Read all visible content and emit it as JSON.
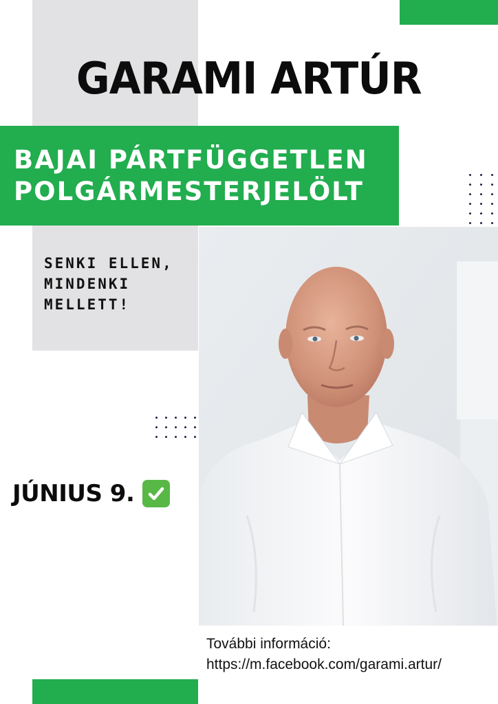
{
  "poster": {
    "name": "GARAMI ARTÚR",
    "title_line1": "BAJAI PÁRTFÜGGETLEN",
    "title_line2": "POLGÁRMESTERJELÖLT",
    "slogan_line1": "SENKI ELLEN,",
    "slogan_line2": "MINDENKI",
    "slogan_line3": "MELLETT!",
    "date": "JÚNIUS 9.",
    "date_icon": "check-mark-button-icon",
    "info_label": "További információ:",
    "info_link": "https://m.facebook.com/garami.artur/"
  },
  "colors": {
    "accent_green": "#22ad4f",
    "panel_gray": "#e2e2e4",
    "text_dark": "#0c0c0c",
    "check_green": "#58b846",
    "dot_color": "#1c2540"
  }
}
